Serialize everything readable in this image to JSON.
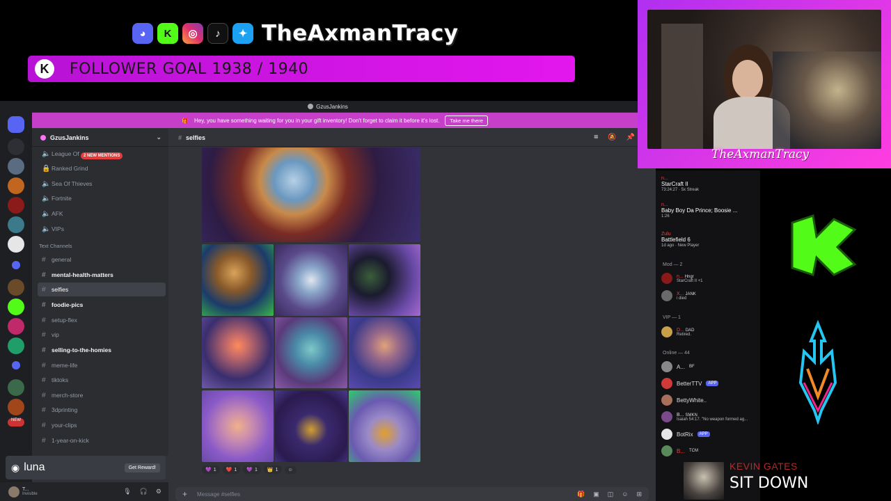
{
  "overlay": {
    "brand_name": "TheAxmanTracy",
    "social_icons": [
      "discord-icon",
      "kick-icon",
      "instagram-icon",
      "tiktok-icon",
      "twitter-icon"
    ],
    "goal_logo": "K",
    "goal_text": "FOLLOWER GOAL 1938 / 1940",
    "cam_name": "TheAxmanTracy",
    "now_playing": {
      "artist": "KEVIN GATES",
      "title": "SIT DOWN"
    },
    "accent_colors": {
      "goal": "#e317ee",
      "kick_green": "#53fc18"
    }
  },
  "discord": {
    "window_title": "GzusJankins",
    "notice": {
      "text": "Hey, you have something waiting for you in your gift inventory! Don't forget to claim it before it's lost.",
      "button": "Take me there"
    },
    "server_name": "GzusJankins",
    "mentions_pill": "2 NEW MENTIONS",
    "voice_channels": [
      "League Of",
      "Ranked Grind",
      "Sea Of Thieves",
      "Fortnite",
      "AFK",
      "VIPs"
    ],
    "text_category": "Text Channels",
    "text_channels": [
      "general",
      "mental-health-matters",
      "selfies",
      "foodie-pics",
      "setup-flex",
      "vip",
      "selling-to-the-homies",
      "meme-life",
      "tiktoks",
      "merch-store",
      "3dprinting",
      "your-clips",
      "1-year-on-kick"
    ],
    "active_channel": "selfies",
    "header_channel": "selfies",
    "luna": {
      "name": "luna",
      "button": "Get Reward!"
    },
    "user_panel": {
      "name": "T...",
      "status": "Invisible"
    },
    "reactions": [
      {
        "emoji": "💜",
        "count": "1"
      },
      {
        "emoji": "❤️",
        "count": "1"
      },
      {
        "emoji": "💜",
        "count": "1"
      },
      {
        "emoji": "👑",
        "count": "1"
      }
    ],
    "composer_placeholder": "Message #selfies"
  },
  "members": {
    "activities": [
      {
        "name": "n...",
        "detail": "StarCraft II",
        "sub": "73:24:27 · 5x Streak"
      },
      {
        "name": "n...",
        "detail": "Baby Boy Da Prince; Boosie ...",
        "sub": "1:26"
      },
      {
        "name": "Zulu",
        "detail": "Battlefield 6",
        "sub": "1d ago · New Player"
      }
    ],
    "groups": [
      {
        "label": "Mod — 2",
        "members": [
          {
            "name": "n...",
            "tag": "Hngr",
            "status": "StarCraft II +1"
          },
          {
            "name": "X...",
            "tag": "JANK",
            "status": "i died"
          }
        ]
      },
      {
        "label": "VIP — 1",
        "members": [
          {
            "name": "D...",
            "tag": "DAD",
            "status": "Retired."
          }
        ]
      },
      {
        "label": "Online — 44",
        "members": [
          {
            "name": "A...",
            "tag": "BF",
            "status": ""
          },
          {
            "name": "BetterTTV",
            "tag": "APP",
            "status": ""
          },
          {
            "name": "BettyWhite..",
            "tag": "",
            "status": ""
          },
          {
            "name": "B...",
            "tag": "SMKN",
            "status": "Isaiah 54:17. \"No weapon formed ag..."
          },
          {
            "name": "BotRix",
            "tag": "APP",
            "status": ""
          },
          {
            "name": "B...",
            "tag": "TCM",
            "status": ""
          }
        ]
      }
    ]
  }
}
